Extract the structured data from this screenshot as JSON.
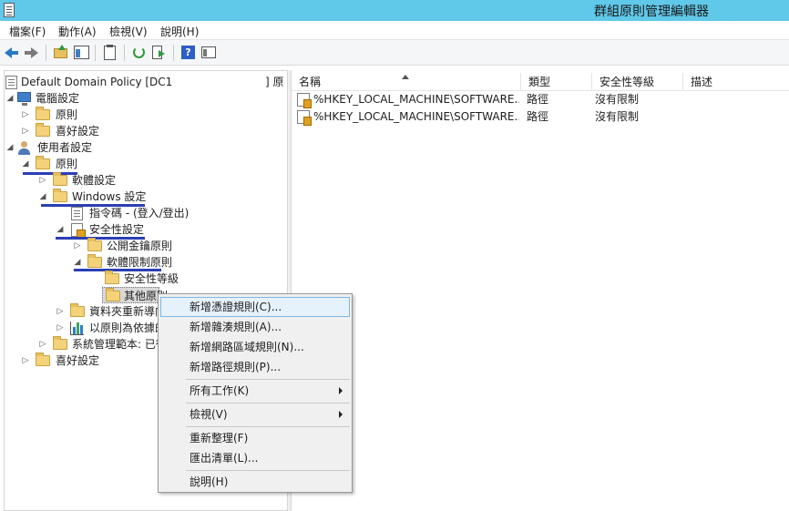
{
  "window": {
    "title": "群組原則管理編輯器"
  },
  "menu": {
    "items": [
      "檔案(F)",
      "動作(A)",
      "檢視(V)",
      "說明(H)"
    ]
  },
  "toolbar": {
    "buttons": [
      "back-icon",
      "forward-icon",
      "up-folder-icon",
      "show-hide-tree-icon",
      "clipboard-icon",
      "refresh-icon",
      "export-list-icon",
      "help-icon",
      "properties-icon"
    ]
  },
  "tree": {
    "root": "Default Domain Policy [DC1",
    "root_suffix": "] 原",
    "computer": "電腦設定",
    "c_policies": "原則",
    "c_preferences": "喜好設定",
    "user": "使用者設定",
    "u_policies": "原則",
    "software": "軟體設定",
    "windows": "Windows 設定",
    "scripts": "指令碼 - (登入/登出)",
    "security": "安全性設定",
    "public_key": "公開金鑰原則",
    "srp": "軟體限制原則",
    "security_levels": "安全性等級",
    "additional_rules": "其他原則",
    "folder_redirect": "資料夾重新導向",
    "policy_qos": "以原則為依據的",
    "admin_templates": "系統管理範本: 已從",
    "u_preferences": "喜好設定"
  },
  "list": {
    "columns": [
      "名稱",
      "類型",
      "安全性等級",
      "描述"
    ],
    "rows": [
      {
        "name": "%HKEY_LOCAL_MACHINE\\SOFTWARE...",
        "type": "路徑",
        "level": "沒有限制",
        "desc": ""
      },
      {
        "name": "%HKEY_LOCAL_MACHINE\\SOFTWARE...",
        "type": "路徑",
        "level": "沒有限制",
        "desc": ""
      }
    ]
  },
  "context_menu": {
    "new_cert": "新增憑證規則(C)...",
    "new_hash": "新增雜湊規則(A)...",
    "new_zone": "新增網路區域規則(N)...",
    "new_path": "新增路徑規則(P)...",
    "all_tasks": "所有工作(K)",
    "view": "檢視(V)",
    "refresh": "重新整理(F)",
    "export": "匯出清單(L)...",
    "help": "說明(H)"
  },
  "colors": {
    "titlebar": "#60c8e8",
    "highlight_underline": "#2b3fb4",
    "menu_hot": "#e5f1fb"
  }
}
